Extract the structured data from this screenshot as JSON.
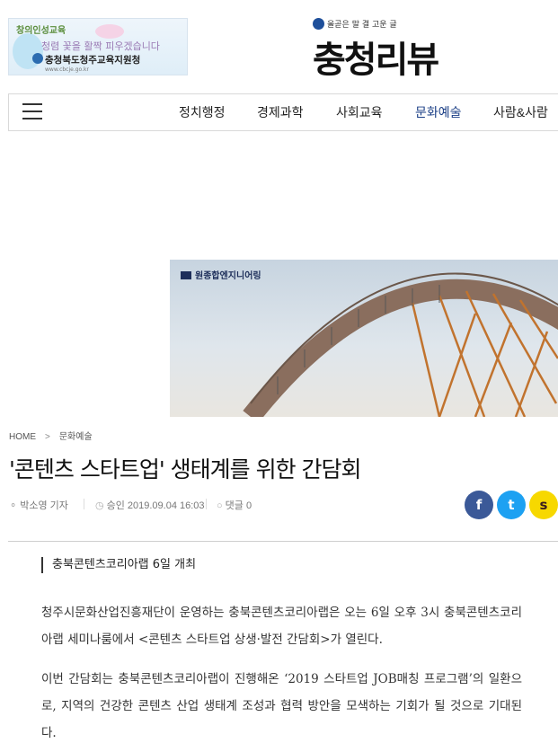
{
  "top_banner": {
    "line1": "창의인성교육",
    "slogan": "청렴 꽃을 활짝 피우겠습니다",
    "org": "충청북도청주교육지원청",
    "tiny": "www.cbcje.go.kr"
  },
  "brand": {
    "tagline": "올곧은 말 결 고운 글",
    "name": "충청리뷰"
  },
  "nav": {
    "menu_icon": "hamburger-menu-icon",
    "items": [
      {
        "label": "정치행정"
      },
      {
        "label": "경제과학"
      },
      {
        "label": "사회교육"
      },
      {
        "label": "문화예술"
      },
      {
        "label": "사람&사람"
      }
    ],
    "active_color": "#1b3f86"
  },
  "ad": {
    "logo_text": "원종합엔지니어링"
  },
  "breadcrumb": {
    "home": "HOME",
    "separator": ">",
    "section": "문화예술"
  },
  "article": {
    "title": "'콘텐츠 스타트업' 생태계를 위한 간담회",
    "author": "박소영 기자",
    "approved": "승인 2019.09.04 16:03",
    "comments": "댓글 0",
    "subhead": "충북콘텐츠코리아랩 6일 개최",
    "paragraphs": [
      "청주시문화산업진흥재단이 운영하는 충북콘텐츠코리아랩은 오는 6일 오후 3시 충북콘텐츠코리아랩 세미나룸에서 <콘텐츠 스타트업 상생·발전 간담회>가 열린다.",
      "이번 간담회는 충북콘텐츠코리아랩이 진행해온 ‘2019 스타트업 JOB매칭 프로그램’의 일환으로, 지역의 건강한 콘텐츠 산업 생태계 조성과 협력 방안을 모색하는 기회가 될 것으로 기대된다."
    ]
  },
  "share": {
    "facebook": "f",
    "twitter": "t",
    "kakaostory": "s",
    "colors": {
      "facebook": "#3b5998",
      "twitter": "#1da1f2",
      "kakaostory": "#f7d800"
    }
  }
}
